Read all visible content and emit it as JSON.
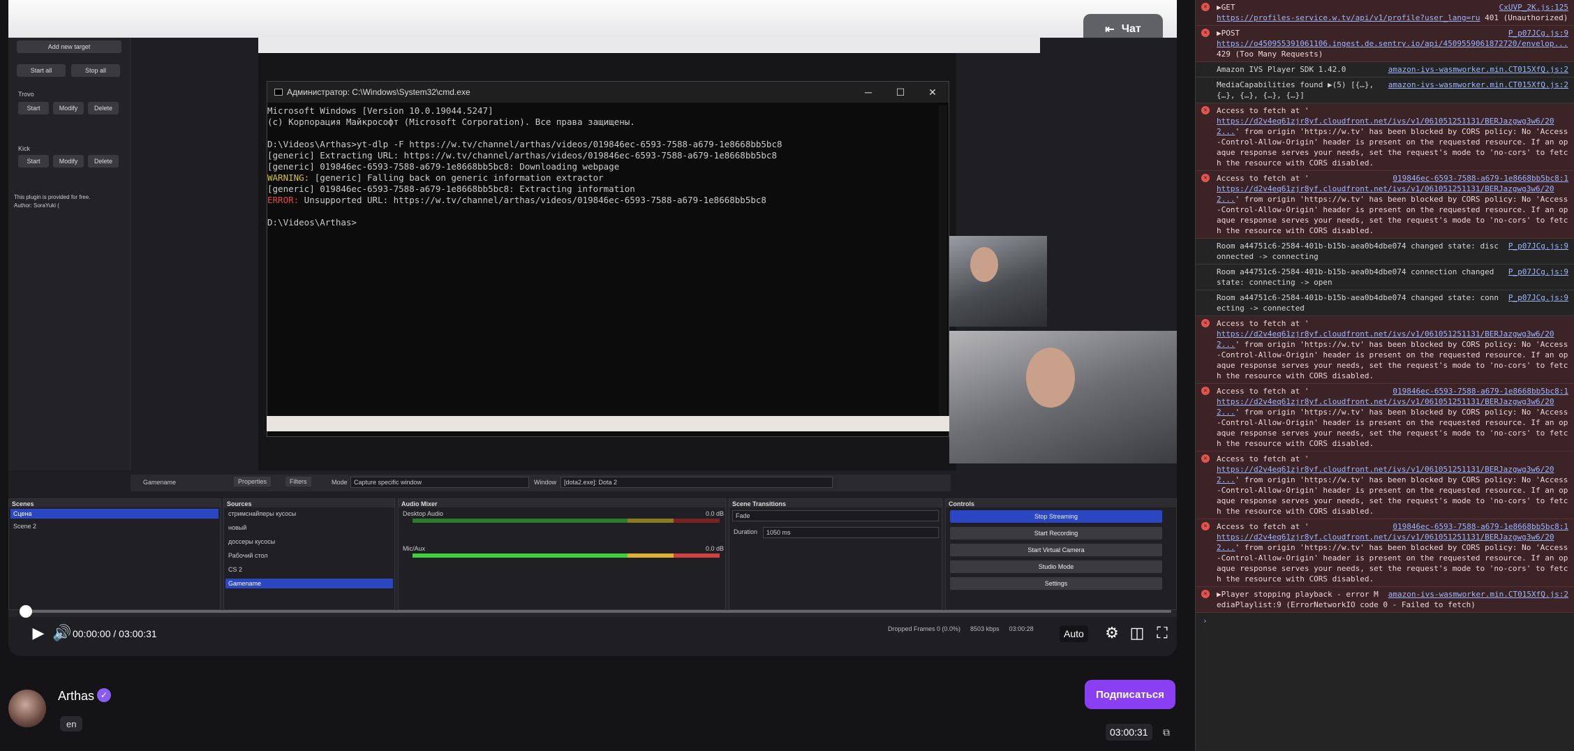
{
  "player": {
    "chat_button": "Чат",
    "time": "00:00:00 / 03:00:31",
    "quality": "Auto",
    "progress_fraction": 0.0
  },
  "obs": {
    "left_panel": {
      "add_target": "Add new target",
      "start_all": "Start all",
      "stop_all": "Stop all",
      "trovo_label": "Trovo",
      "kick_label": "Kick",
      "start": "Start",
      "modify": "Modify",
      "delete": "Delete",
      "plugin_note": "This plugin is provided for free.",
      "author": "Author: SoraYuki ("
    },
    "toolbar": {
      "source_name": "Gamename",
      "properties": "Properties",
      "filters": "Filters",
      "mode_label": "Mode",
      "mode_value": "Capture specific window",
      "window_label": "Window",
      "window_value": "[dota2.exe]: Dota 2"
    },
    "docks": {
      "scenes_title": "Scenes",
      "scenes": [
        "Сцена",
        "Scene 2"
      ],
      "sources_title": "Sources",
      "sources": [
        "стримснайперы кусосы",
        "новый",
        "доссеры кусосы",
        "Рабочий стол",
        "CS 2",
        "Gamename"
      ],
      "mixer_title": "Audio Mixer",
      "mixer_tracks": [
        {
          "name": "Desktop Audio",
          "db": "0.0 dB"
        },
        {
          "name": "Mic/Aux",
          "db": "0.0 dB"
        }
      ],
      "transitions_title": "Scene Transitions",
      "transition_value": "Fade",
      "duration_label": "Duration",
      "duration_value": "1050 ms",
      "controls_title": "Controls",
      "controls": [
        "Stop Streaming",
        "Start Recording",
        "Start Virtual Camera",
        "Studio Mode",
        "Settings"
      ]
    },
    "status_bar": {
      "dropped": "Dropped Frames 0 (0.0%)",
      "kbps": "8503 kbps",
      "elapsed": "03:00:28"
    }
  },
  "cmd": {
    "title": "Администратор: C:\\Windows\\System32\\cmd.exe",
    "lines": [
      {
        "t": "Microsoft Windows [Version 10.0.19044.5247]",
        "c": ""
      },
      {
        "t": "(c) Корпорация Майкрософт (Microsoft Corporation). Все права защищены.",
        "c": ""
      },
      {
        "t": " ",
        "c": ""
      },
      {
        "t": "D:\\Videos\\Arthas>yt-dlp -F https://w.tv/channel/arthas/videos/019846ec-6593-7588-a679-1e8668bb5bc8",
        "c": ""
      },
      {
        "t": "[generic] Extracting URL: https://w.tv/channel/arthas/videos/019846ec-6593-7588-a679-1e8668bb5bc8",
        "c": ""
      },
      {
        "t": "[generic] 019846ec-6593-7588-a679-1e8668bb5bc8: Downloading webpage",
        "c": ""
      },
      {
        "t": "WARNING:",
        "c": "warn",
        "rest": " [generic] Falling back on generic information extractor"
      },
      {
        "t": "[generic] 019846ec-6593-7588-a679-1e8668bb5bc8: Extracting information",
        "c": ""
      },
      {
        "t": "ERROR:",
        "c": "err",
        "rest": " Unsupported URL: https://w.tv/channel/arthas/videos/019846ec-6593-7588-a679-1e8668bb5bc8"
      },
      {
        "t": " ",
        "c": ""
      },
      {
        "t": "D:\\Videos\\Arthas>",
        "c": ""
      }
    ]
  },
  "channel": {
    "name": "Arthas",
    "language": "en",
    "subscribe": "Подписаться",
    "duration": "03:00:31"
  },
  "console": {
    "messages": [
      {
        "kind": "error",
        "text": "▶GET",
        "link": "https://profiles-service.w.tv/api/v1/profile?user_lang=ru",
        "tail": " 401 (Unauthorized)",
        "src": "CxUVP_2K.js:125"
      },
      {
        "kind": "error",
        "text": "▶POST",
        "link": "https://o450955391061106.ingest.de.sentry.io/api/4509559061872720/envelop...",
        "tail": " 429 (Too Many Requests)",
        "src": "P_p07JCg.js:9"
      },
      {
        "kind": "info",
        "text": "Amazon IVS Player SDK 1.42.0",
        "link": "",
        "tail": "",
        "src": "amazon-ivs-wasmworker.min.CT015XfQ.js:2"
      },
      {
        "kind": "info",
        "text": "MediaCapabilities found",
        "link": "",
        "tail": " ▶(5) [{…}, {…}, {…}, {…}, {…}]",
        "src": "amazon-ivs-wasmworker.min.CT015XfQ.js:2"
      },
      {
        "kind": "error",
        "text": "Access to fetch at '",
        "link": "https://d2v4eq61zjr8yf.cloudfront.net/ivs/v1/061051251131/BERJazgwg3w6/202...",
        "tail": "' from origin 'https://w.tv' has been blocked by CORS policy: No 'Access-Control-Allow-Origin' header is present on the requested resource. If an opaque response serves your needs, set the request's mode to 'no-cors' to fetch the resource with CORS disabled.",
        "src": ""
      },
      {
        "kind": "error",
        "text": "Access to fetch at '",
        "link": "https://d2v4eq61zjr8yf.cloudfront.net/ivs/v1/061051251131/BERJazgwg3w6/202...",
        "tail": "' from origin 'https://w.tv' has been blocked by CORS policy: No 'Access-Control-Allow-Origin' header is present on the requested resource. If an opaque response serves your needs, set the request's mode to 'no-cors' to fetch the resource with CORS disabled.",
        "src": "019846ec-6593-7588-a679-1e8668bb5bc8:1"
      },
      {
        "kind": "info",
        "text": "Room a44751c6-2584-401b-b15b-aea0b4dbe074 changed state: disconnected -> connecting",
        "link": "",
        "tail": "",
        "src": "P_p07JCg.js:9"
      },
      {
        "kind": "info",
        "text": "Room a44751c6-2584-401b-b15b-aea0b4dbe074 connection changed state: connecting -> open",
        "link": "",
        "tail": "",
        "src": "P_p07JCg.js:9"
      },
      {
        "kind": "info",
        "text": "Room a44751c6-2584-401b-b15b-aea0b4dbe074 changed state: connecting -> connected",
        "link": "",
        "tail": "",
        "src": "P_p07JCg.js:9"
      },
      {
        "kind": "error",
        "text": "Access to fetch at '",
        "link": "https://d2v4eq61zjr8yf.cloudfront.net/ivs/v1/061051251131/BERJazgwg3w6/202...",
        "tail": "' from origin 'https://w.tv' has been blocked by CORS policy: No 'Access-Control-Allow-Origin' header is present on the requested resource. If an opaque response serves your needs, set the request's mode to 'no-cors' to fetch the resource with CORS disabled.",
        "src": ""
      },
      {
        "kind": "error",
        "text": "Access to fetch at '",
        "link": "https://d2v4eq61zjr8yf.cloudfront.net/ivs/v1/061051251131/BERJazgwg3w6/202...",
        "tail": "' from origin 'https://w.tv' has been blocked by CORS policy: No 'Access-Control-Allow-Origin' header is present on the requested resource. If an opaque response serves your needs, set the request's mode to 'no-cors' to fetch the resource with CORS disabled.",
        "src": "019846ec-6593-7588-a679-1e8668bb5bc8:1"
      },
      {
        "kind": "error",
        "text": "Access to fetch at '",
        "link": "https://d2v4eq61zjr8yf.cloudfront.net/ivs/v1/061051251131/BERJazgwg3w6/202...",
        "tail": "' from origin 'https://w.tv' has been blocked by CORS policy: No 'Access-Control-Allow-Origin' header is present on the requested resource. If an opaque response serves your needs, set the request's mode to 'no-cors' to fetch the resource with CORS disabled.",
        "src": ""
      },
      {
        "kind": "error",
        "text": "Access to fetch at '",
        "link": "https://d2v4eq61zjr8yf.cloudfront.net/ivs/v1/061051251131/BERJazgwg3w6/202...",
        "tail": "' from origin 'https://w.tv' has been blocked by CORS policy: No 'Access-Control-Allow-Origin' header is present on the requested resource. If an opaque response serves your needs, set the request's mode to 'no-cors' to fetch the resource with CORS disabled.",
        "src": "019846ec-6593-7588-a679-1e8668bb5bc8:1"
      },
      {
        "kind": "error",
        "text": "▶Player stopping playback - error MediaPlaylist:9 (ErrorNetworkIO code 0 - Failed to fetch)",
        "link": "",
        "tail": "",
        "src": "amazon-ivs-wasmworker.min.CT015XfQ.js:2"
      }
    ],
    "prompt": "›"
  }
}
